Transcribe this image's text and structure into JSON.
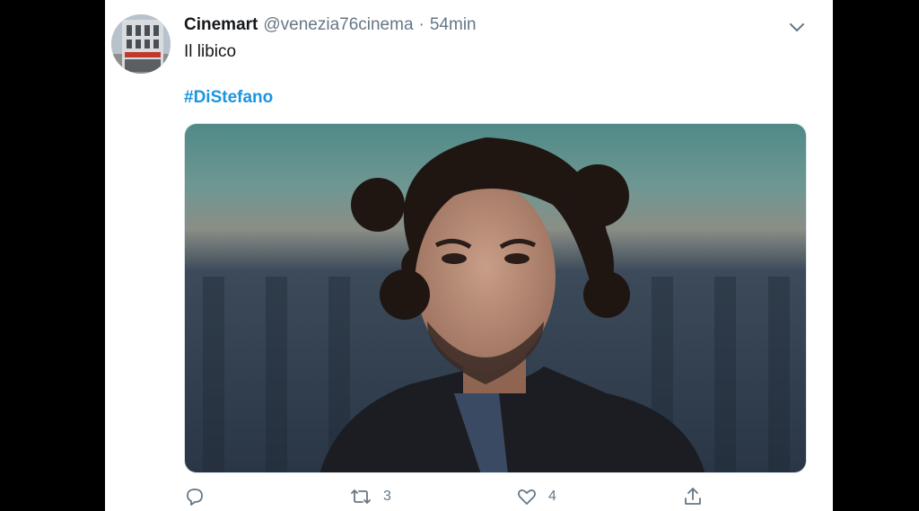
{
  "tweet": {
    "name": "Cinemart",
    "handle": "@venezia76cinema",
    "separator": "·",
    "time": "54min",
    "text": "Il libico",
    "hashtag": "#DiStefano"
  },
  "actions": {
    "reply_count": "",
    "retweet_count": "3",
    "like_count": "4"
  },
  "icons": {
    "avatar": "building-photo",
    "menu": "chevron-down-icon",
    "reply": "speech-bubble-icon",
    "retweet": "retweet-arrows-icon",
    "like": "heart-icon",
    "share": "upload-share-icon"
  },
  "colors": {
    "background": "#000000",
    "card": "#ffffff",
    "text": "#14171a",
    "muted": "#657786",
    "link": "#1b95e0"
  }
}
